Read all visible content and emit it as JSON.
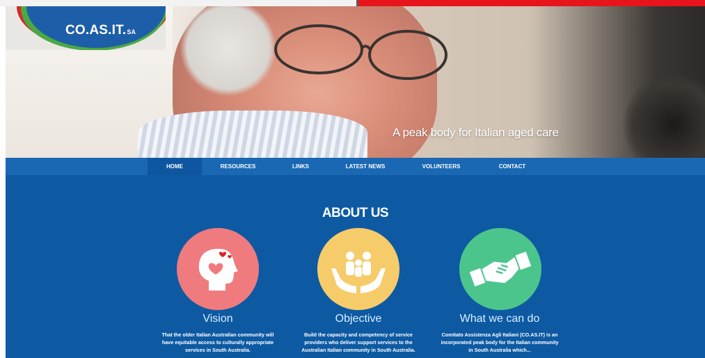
{
  "brand": {
    "logo_text": "CO.AS.IT.",
    "logo_suffix": "SA",
    "colors": {
      "red": "#d9252b",
      "green": "#4aa943",
      "blue": "#1d5ea8"
    }
  },
  "hero": {
    "tagline": "A peak body for Italian aged care"
  },
  "nav": {
    "items": [
      {
        "label": "HOME",
        "active": true
      },
      {
        "label": "RESOURCES"
      },
      {
        "label": "LINKS"
      },
      {
        "label": "LATEST NEWS"
      },
      {
        "label": "VOLUNTEERS"
      },
      {
        "label": "CONTACT"
      }
    ]
  },
  "about": {
    "heading": "ABOUT US",
    "columns": [
      {
        "icon": "head-heart-icon",
        "title": "Vision",
        "text_lines": [
          "That the older Italian Australian community will",
          "have equitable access to culturally appropriate",
          "services in South Australia."
        ],
        "color": "#f07b7e"
      },
      {
        "icon": "hands-family-icon",
        "title": "Objective",
        "text_lines": [
          "Build the capacity and competency of service",
          "providers who deliver support services to the",
          "Australian Italian community in South Australia."
        ],
        "color": "#f6cc6a"
      },
      {
        "icon": "handshake-icon",
        "title": "What we can do",
        "text_lines": [
          "Comitato Assistenza Agli Italiani (CO.AS.IT) is an",
          "incorporated peak body for the Italian community",
          "in South Australia which..."
        ],
        "color": "#4cc58d"
      }
    ]
  },
  "colors": {
    "nav_bg": "#1a68b3",
    "main_bg": "#0d5aa3",
    "top_accent": "#e8141b"
  }
}
